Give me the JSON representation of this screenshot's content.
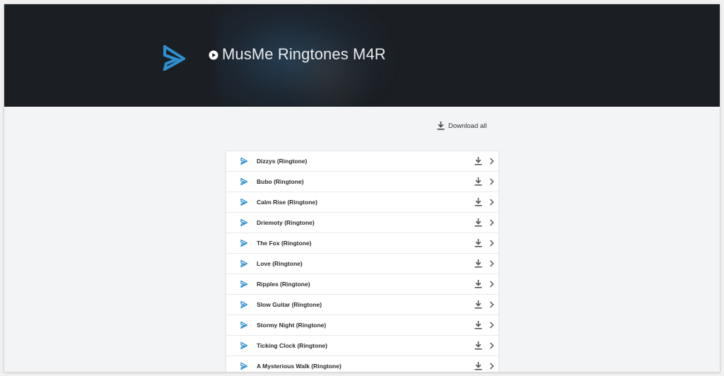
{
  "header": {
    "title": "MusMe Ringtones M4R",
    "brand_color": "#2d8fd0"
  },
  "actions": {
    "download_all_label": "Download all"
  },
  "ringtones": [
    {
      "name": "Dizzys (Ringtone)"
    },
    {
      "name": "Bubo (Ringtone)"
    },
    {
      "name": "Calm Rise (Ringtone)"
    },
    {
      "name": "Driemoty (Ringtone)"
    },
    {
      "name": "The Fox (Ringtone)"
    },
    {
      "name": "Love (Ringtone)"
    },
    {
      "name": "Ripples (Ringtone)"
    },
    {
      "name": "Slow Guitar (Ringtone)"
    },
    {
      "name": "Stormy Night (Ringtone)"
    },
    {
      "name": "Ticking Clock (Ringtone)"
    },
    {
      "name": "A Mysterious Walk (Ringtone)"
    }
  ],
  "icons": {
    "logo": "musme-logo-icon",
    "title_prefix": "play-circle-icon",
    "row_type": "musme-triangle-icon",
    "row_download": "download-icon",
    "row_open": "chevron-right-icon"
  }
}
